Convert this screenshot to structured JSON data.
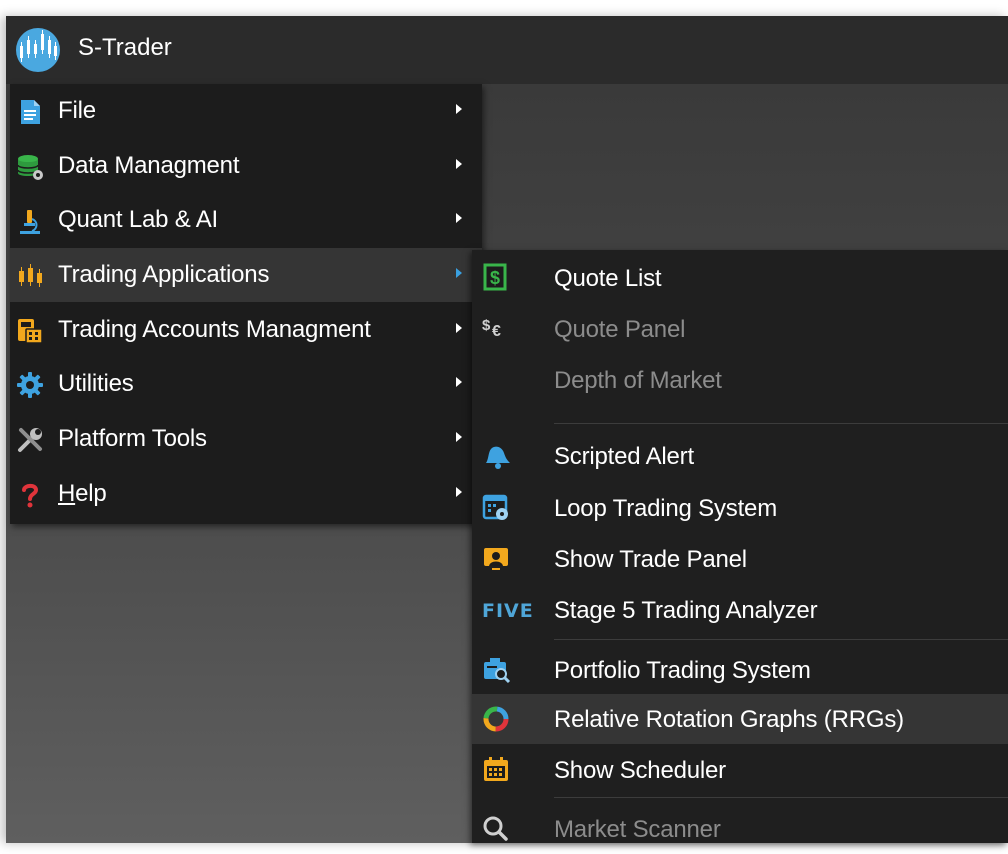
{
  "app": {
    "title": "S-Trader"
  },
  "main_menu": {
    "items": [
      {
        "label": "File",
        "icon": "document-icon",
        "has_submenu": true
      },
      {
        "label": "Data Managment",
        "icon": "database-gear-icon",
        "has_submenu": true
      },
      {
        "label": "Quant Lab & AI",
        "icon": "microscope-icon",
        "has_submenu": true
      },
      {
        "label": "Trading Applications",
        "icon": "candlestick-icon",
        "has_submenu": true,
        "highlighted": true
      },
      {
        "label": "Trading Accounts Managment",
        "icon": "calculator-icon",
        "has_submenu": true
      },
      {
        "label": "Utilities",
        "icon": "gear-icon",
        "has_submenu": true
      },
      {
        "label": "Platform Tools",
        "icon": "tools-icon",
        "has_submenu": true
      },
      {
        "label_mnemonic": "H",
        "label_rest": "elp",
        "icon": "question-icon",
        "has_submenu": true
      }
    ]
  },
  "submenu": {
    "items": [
      {
        "label": "Quote List",
        "icon": "dollar-note-icon",
        "enabled": true
      },
      {
        "label": "Quote Panel",
        "icon": "currency-icon",
        "enabled": false
      },
      {
        "label": "Depth of Market",
        "icon": "",
        "enabled": false
      },
      {
        "label": "Scripted Alert",
        "icon": "bell-icon",
        "enabled": true
      },
      {
        "label": "Loop Trading System",
        "icon": "calendar-gear-icon",
        "enabled": true
      },
      {
        "label": "Show Trade Panel",
        "icon": "trade-panel-icon",
        "enabled": true
      },
      {
        "label": "Stage 5 Trading Analyzer",
        "icon_text": "FIVE",
        "enabled": true
      },
      {
        "label": "Portfolio Trading System",
        "icon": "portfolio-search-icon",
        "enabled": true
      },
      {
        "label": "Relative Rotation Graphs (RRGs)",
        "icon": "rrg-ring-icon",
        "enabled": true,
        "highlighted": true
      },
      {
        "label": "Show Scheduler",
        "icon": "calendar-icon",
        "enabled": true
      },
      {
        "label": "Market Scanner",
        "icon": "search-icon",
        "enabled": false
      }
    ]
  },
  "colors": {
    "menu_background": "#1c1c1c",
    "highlight": "#353535",
    "accent_blue": "#3aa0e0",
    "disabled_text": "#8c8c8c",
    "help_icon": "#e0343b"
  }
}
